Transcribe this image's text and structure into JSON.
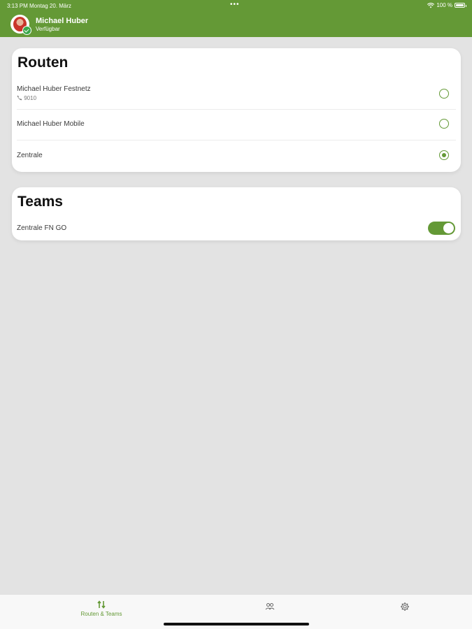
{
  "status_bar": {
    "time_date": "3:13 PM   Montag 20. März",
    "dots": "•••",
    "battery": "100 %"
  },
  "header": {
    "user_name": "Michael Huber",
    "user_status": "Verfügbar",
    "background_color": "#649936"
  },
  "routes": {
    "title": "Routen",
    "items": [
      {
        "label": "Michael Huber Festnetz",
        "sub": "9010",
        "selected": false
      },
      {
        "label": "Michael Huber Mobile",
        "selected": false
      },
      {
        "label": "Zentrale",
        "selected": true
      }
    ]
  },
  "teams": {
    "title": "Teams",
    "items": [
      {
        "label": "Zentrale FN GO",
        "enabled": true
      }
    ]
  },
  "tabbar": {
    "tabs": [
      {
        "label": "Routen & Teams",
        "icon": "routes-icon",
        "active": true
      },
      {
        "label": "",
        "icon": "contacts-icon",
        "active": false
      },
      {
        "label": "",
        "icon": "gear-icon",
        "active": false
      }
    ]
  },
  "accent_color": "#649936"
}
